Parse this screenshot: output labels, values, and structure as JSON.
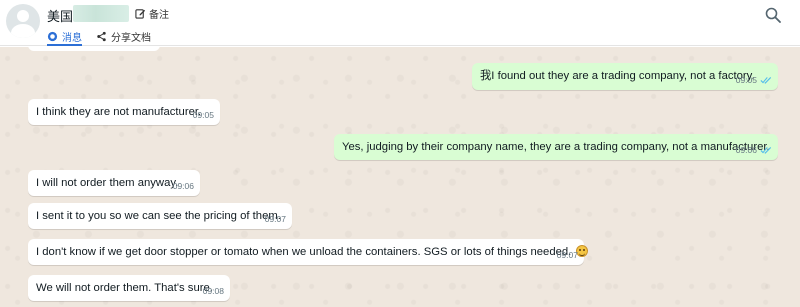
{
  "header": {
    "contact_name": "美国",
    "note_label": "备注",
    "tabs": [
      {
        "label": "消息"
      },
      {
        "label": "分享文档"
      }
    ]
  },
  "messages": [
    {
      "direction": "out",
      "text": "我I found out they are a trading company, not a factory.",
      "time": "09:05",
      "read": true
    },
    {
      "direction": "in",
      "text": "I think they are not manufacturer.",
      "time": "09:05"
    },
    {
      "direction": "out",
      "text": "Yes, judging by their company name, they are a trading company, not a manufacturer.",
      "time": "09:06",
      "read": true
    },
    {
      "direction": "in",
      "text": "I will not order them anyway.",
      "time": "09:06"
    },
    {
      "direction": "in",
      "text": "I sent it to you so we can see the pricing of them.",
      "time": "09:07"
    },
    {
      "direction": "in",
      "text": "I don't know if we get door stopper or tomato when we unload the containers. SGS or lots of things needed.",
      "emoji": "grinning-face",
      "time": "09:07"
    },
    {
      "direction": "in",
      "text": "We will not order them. That's sure.",
      "time": "09:08"
    }
  ],
  "colors": {
    "incoming_bubble": "#ffffff",
    "outgoing_bubble": "#d9fdd3",
    "chat_background": "#efe7de",
    "read_ticks": "#53bdeb",
    "active_tab": "#2c6fd6"
  }
}
